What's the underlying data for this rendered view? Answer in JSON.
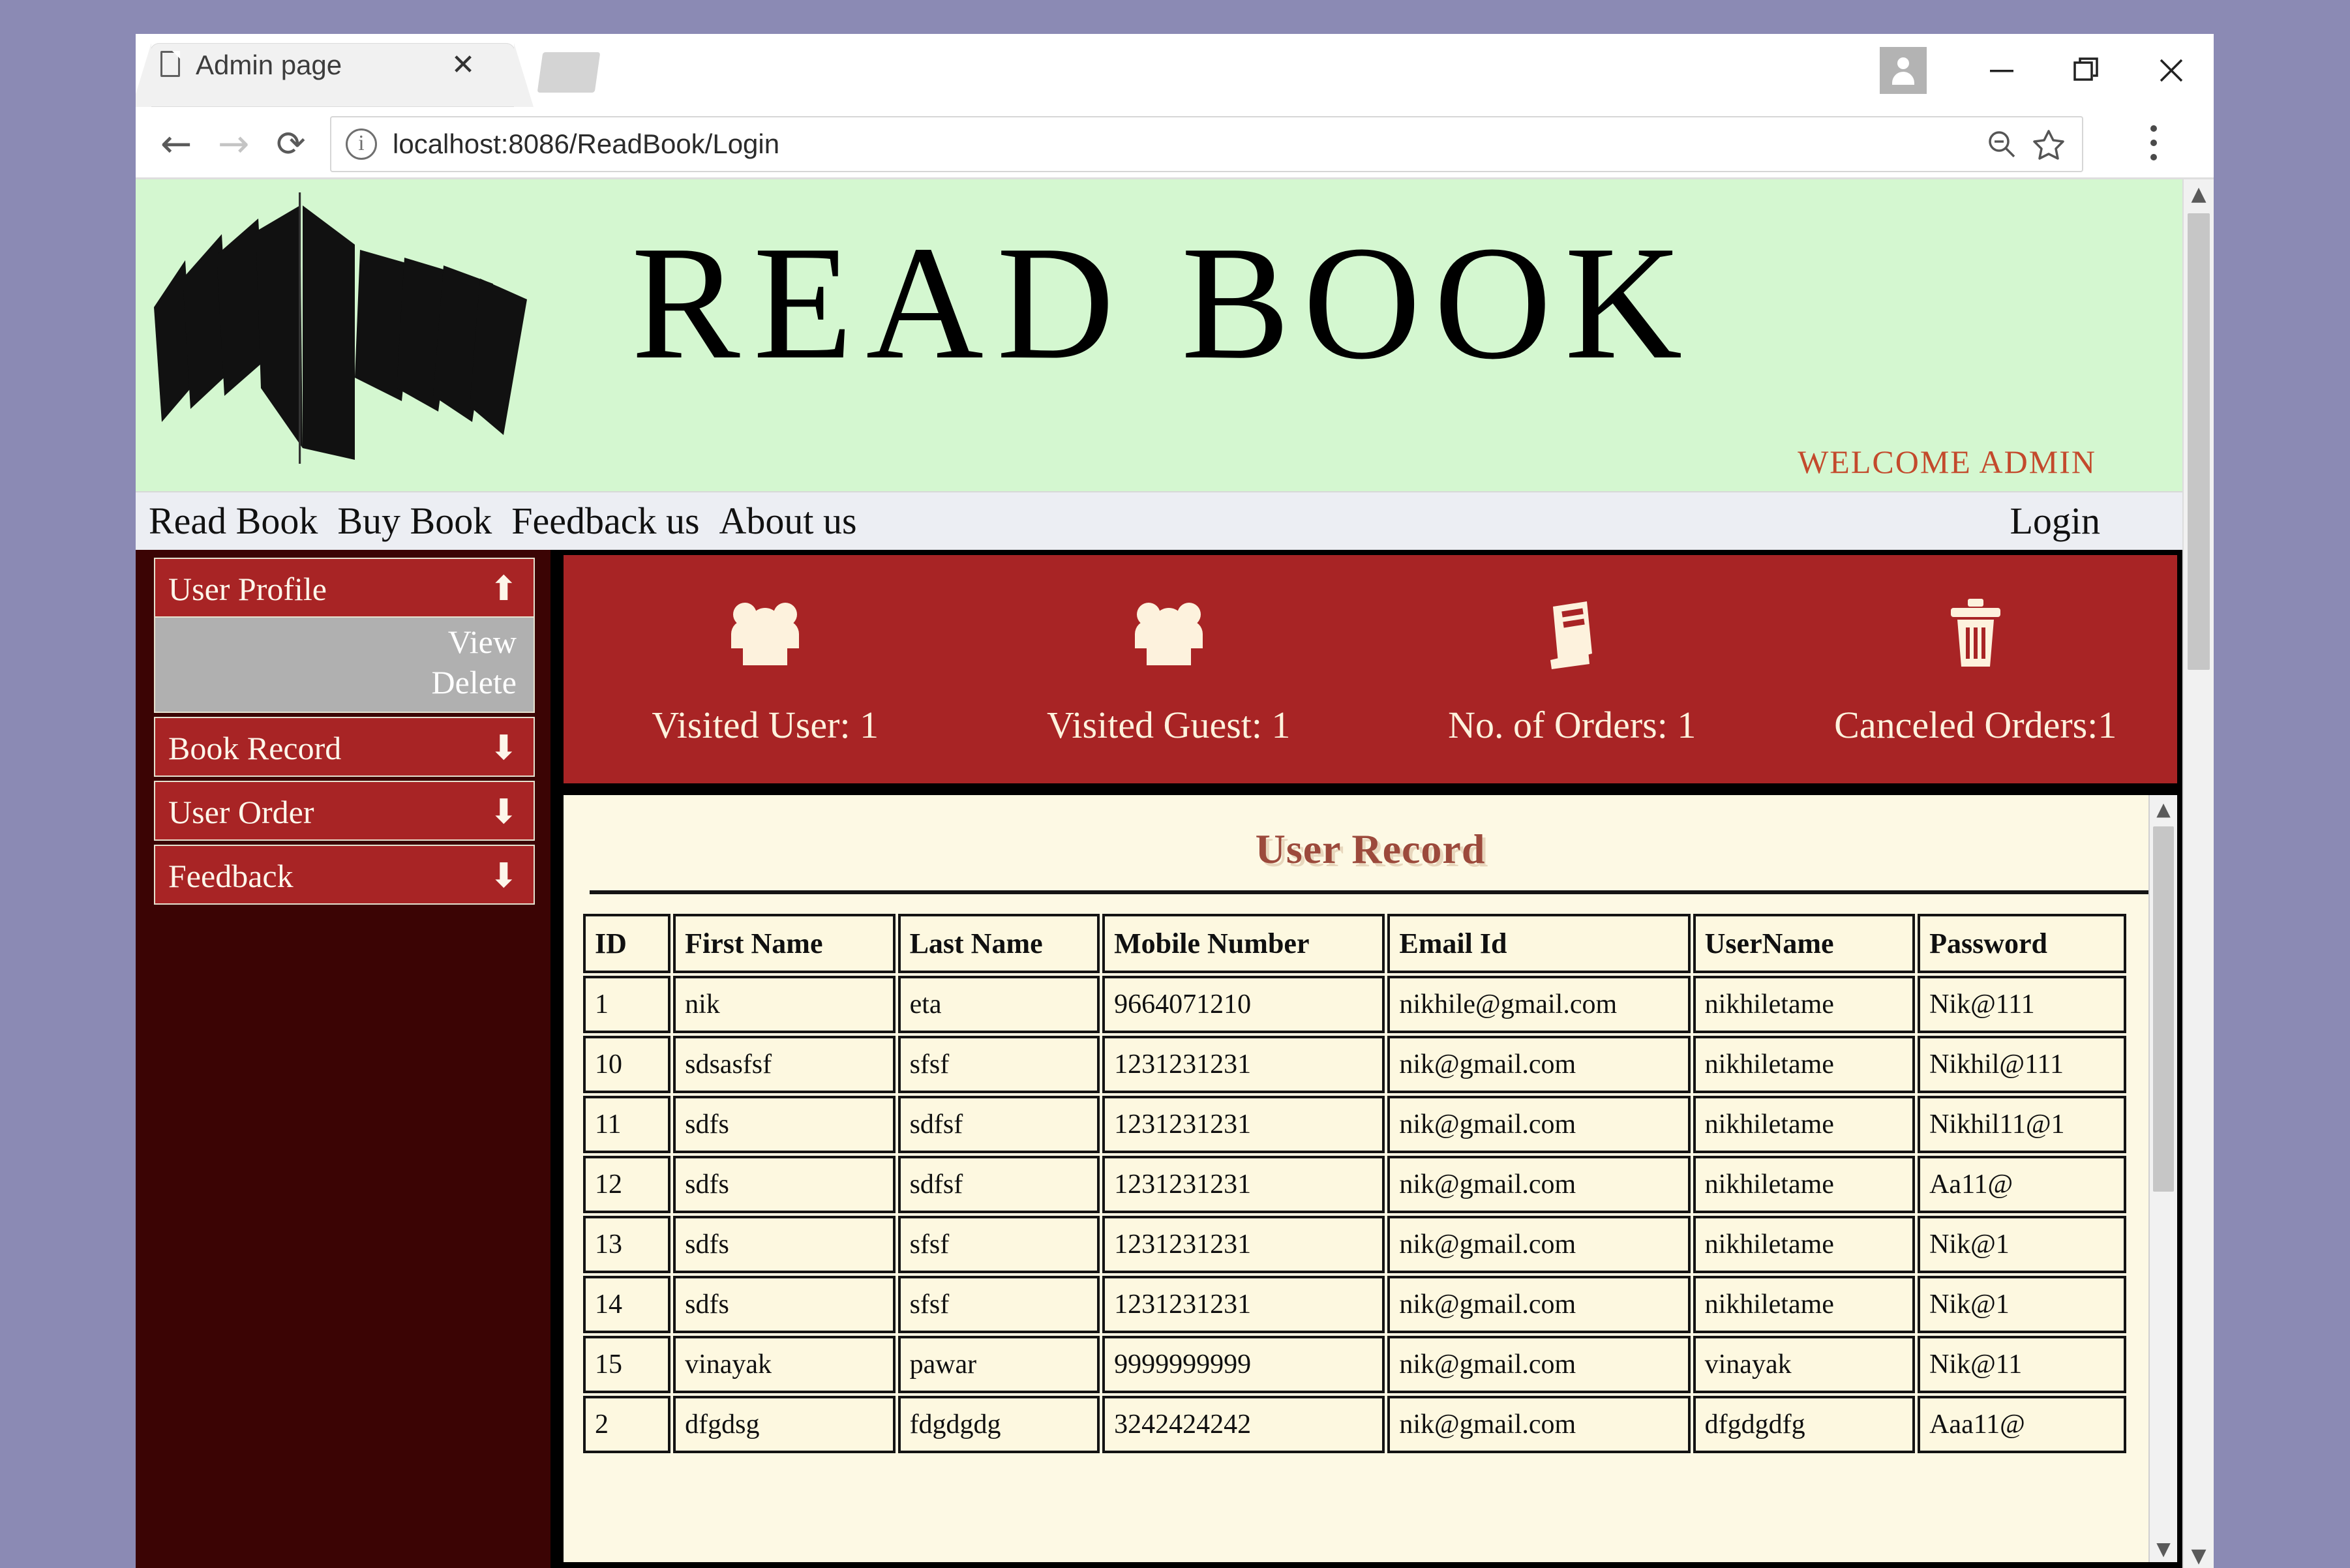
{
  "browser": {
    "tab_title": "Admin page",
    "tab_close_glyph": "✕",
    "url": "localhost:8086/ReadBook/Login",
    "back_glyph": "←",
    "forward_glyph": "→",
    "reload_glyph": "⟳",
    "minimize_glyph": "—",
    "scroll_up_glyph": "▲",
    "scroll_down_glyph": "▼"
  },
  "site": {
    "title": "READ BOOK",
    "welcome": "WELCOME ADMIN",
    "banner_bg": "#d4f7d0",
    "welcome_color": "#c34a2c"
  },
  "nav": {
    "items": [
      {
        "label": "Read Book"
      },
      {
        "label": "Buy Book"
      },
      {
        "label": "Feedback us"
      },
      {
        "label": "About us"
      }
    ],
    "login": "Login"
  },
  "sidebar": {
    "accent": "#a82425",
    "groups": [
      {
        "label": "User Profile",
        "caret": "⬆",
        "expanded": true,
        "children": [
          {
            "label": "View"
          },
          {
            "label": "Delete"
          }
        ]
      },
      {
        "label": "Book Record",
        "caret": "⬇",
        "expanded": false,
        "children": []
      },
      {
        "label": "User Order",
        "caret": "⬇",
        "expanded": false,
        "children": []
      },
      {
        "label": "Feedback",
        "caret": "⬇",
        "expanded": false,
        "children": []
      }
    ]
  },
  "stats": [
    {
      "icon": "users-icon",
      "label": "Visited User: 1"
    },
    {
      "icon": "users-icon",
      "label": "Visited Guest: 1"
    },
    {
      "icon": "book-icon",
      "label": "No. of Orders: 1"
    },
    {
      "icon": "trash-icon",
      "label": "Canceled Orders:1"
    }
  ],
  "record": {
    "title": "User Record",
    "title_color": "#9c4a3c",
    "columns": [
      "ID",
      "First Name",
      "Last Name",
      "Mobile Number",
      "Email Id",
      "UserName",
      "Password"
    ],
    "rows": [
      [
        "1",
        "nik",
        "eta",
        "9664071210",
        "nikhile@gmail.com",
        "nikhiletame",
        "Nik@111"
      ],
      [
        "10",
        "sdsasfsf",
        "sfsf",
        "1231231231",
        "nik@gmail.com",
        "nikhiletame",
        "Nikhil@111"
      ],
      [
        "11",
        "sdfs",
        "sdfsf",
        "1231231231",
        "nik@gmail.com",
        "nikhiletame",
        "Nikhil11@1"
      ],
      [
        "12",
        "sdfs",
        "sdfsf",
        "1231231231",
        "nik@gmail.com",
        "nikhiletame",
        "Aa11@"
      ],
      [
        "13",
        "sdfs",
        "sfsf",
        "1231231231",
        "nik@gmail.com",
        "nikhiletame",
        "Nik@1"
      ],
      [
        "14",
        "sdfs",
        "sfsf",
        "1231231231",
        "nik@gmail.com",
        "nikhiletame",
        "Nik@1"
      ],
      [
        "15",
        "vinayak",
        "pawar",
        "9999999999",
        "nik@gmail.com",
        "vinayak",
        "Nik@11"
      ],
      [
        "2",
        "dfgdsg",
        "fdgdgdg",
        "3242424242",
        "nik@gmail.com",
        "dfgdgdfg",
        "Aaa11@"
      ]
    ]
  }
}
